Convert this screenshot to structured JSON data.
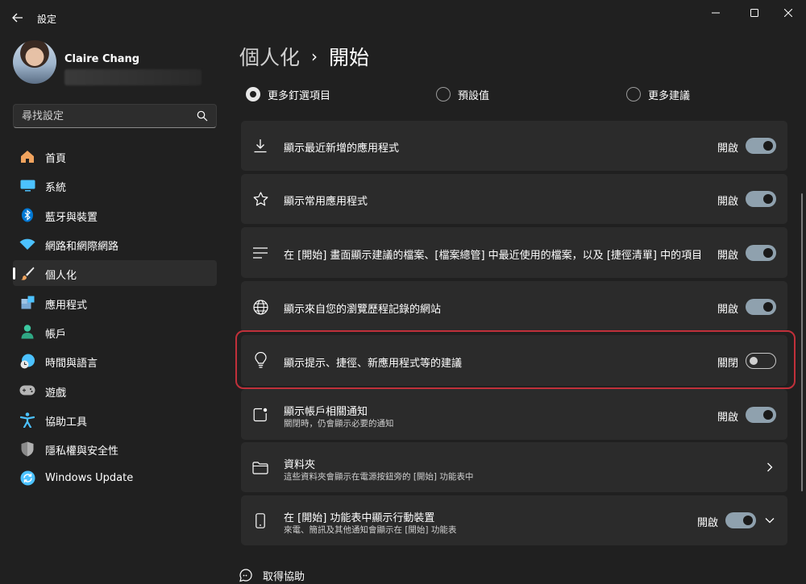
{
  "window": {
    "app_title": "設定",
    "back_icon": "back-arrow-icon",
    "controls": [
      "minimize-icon",
      "maximize-icon",
      "close-icon"
    ]
  },
  "profile": {
    "name": "Claire Chang"
  },
  "search": {
    "placeholder": "尋找設定",
    "icon": "search-icon"
  },
  "nav": {
    "items": [
      {
        "label": "首頁",
        "icon": "home-icon",
        "color": "#f0a35e"
      },
      {
        "label": "系統",
        "icon": "system-monitor-icon",
        "color": "#4cc2ff"
      },
      {
        "label": "藍牙與裝置",
        "icon": "bluetooth-icon",
        "color": "#0078d4"
      },
      {
        "label": "網路和網際網路",
        "icon": "wifi-icon",
        "color": "#4cc2ff"
      },
      {
        "label": "個人化",
        "icon": "paint-brush-icon",
        "color": "#f0a35e",
        "active": true
      },
      {
        "label": "應用程式",
        "icon": "apps-icon",
        "color": "#7aa9d6"
      },
      {
        "label": "帳戶",
        "icon": "account-icon",
        "color": "#3cc8a0"
      },
      {
        "label": "時間與語言",
        "icon": "time-language-icon",
        "color": "#4cc2ff"
      },
      {
        "label": "遊戲",
        "icon": "gamepad-icon",
        "color": "#aaaaaa"
      },
      {
        "label": "協助工具",
        "icon": "accessibility-icon",
        "color": "#4cc2ff"
      },
      {
        "label": "隱私權與安全性",
        "icon": "shield-icon",
        "color": "#8a8a8a"
      },
      {
        "label": "Windows Update",
        "icon": "windows-update-icon",
        "color": "#4cc2ff"
      }
    ]
  },
  "page": {
    "parent": "個人化",
    "separator": "›",
    "title": "開始"
  },
  "layout_options": [
    {
      "label": "更多釘選項目",
      "checked": true
    },
    {
      "label": "預設值",
      "checked": false
    },
    {
      "label": "更多建議",
      "checked": false
    }
  ],
  "settings": [
    {
      "title": "顯示最近新增的應用程式",
      "state": "開啟",
      "on": true,
      "icon": "download-icon"
    },
    {
      "title": "顯示常用應用程式",
      "state": "開啟",
      "on": true,
      "icon": "star-icon"
    },
    {
      "title": "在 [開始] 畫面顯示建議的檔案、[檔案總管] 中最近使用的檔案，以及 [捷徑清單] 中的項目",
      "state": "開啟",
      "on": true,
      "icon": "list-icon"
    },
    {
      "title": "顯示來自您的瀏覽歷程記錄的網站",
      "state": "開啟",
      "on": true,
      "icon": "globe-icon"
    },
    {
      "title": "顯示提示、捷徑、新應用程式等的建議",
      "state": "關閉",
      "on": false,
      "icon": "lightbulb-icon"
    },
    {
      "title": "顯示帳戶相關通知",
      "subtitle": "關閉時，仍會顯示必要的通知",
      "state": "開啟",
      "on": true,
      "icon": "notification-icon"
    },
    {
      "title": "資料夾",
      "subtitle": "這些資料夾會顯示在電源按鈕旁的 [開始] 功能表中",
      "icon": "folder-icon",
      "chevron": "chevron-right-icon"
    },
    {
      "title": "在 [開始] 功能表中顯示行動裝置",
      "subtitle": "來電、簡訊及其他通知會顯示在 [開始] 功能表",
      "state": "開啟",
      "on": true,
      "icon": "phone-icon",
      "chevron": "chevron-down-icon"
    }
  ],
  "help": {
    "label": "取得協助",
    "icon": "help-icon"
  },
  "colors": {
    "background": "#202020",
    "card": "#2b2b2b",
    "toggle_on": "#8fa1ae",
    "highlight": "#c0303a"
  }
}
